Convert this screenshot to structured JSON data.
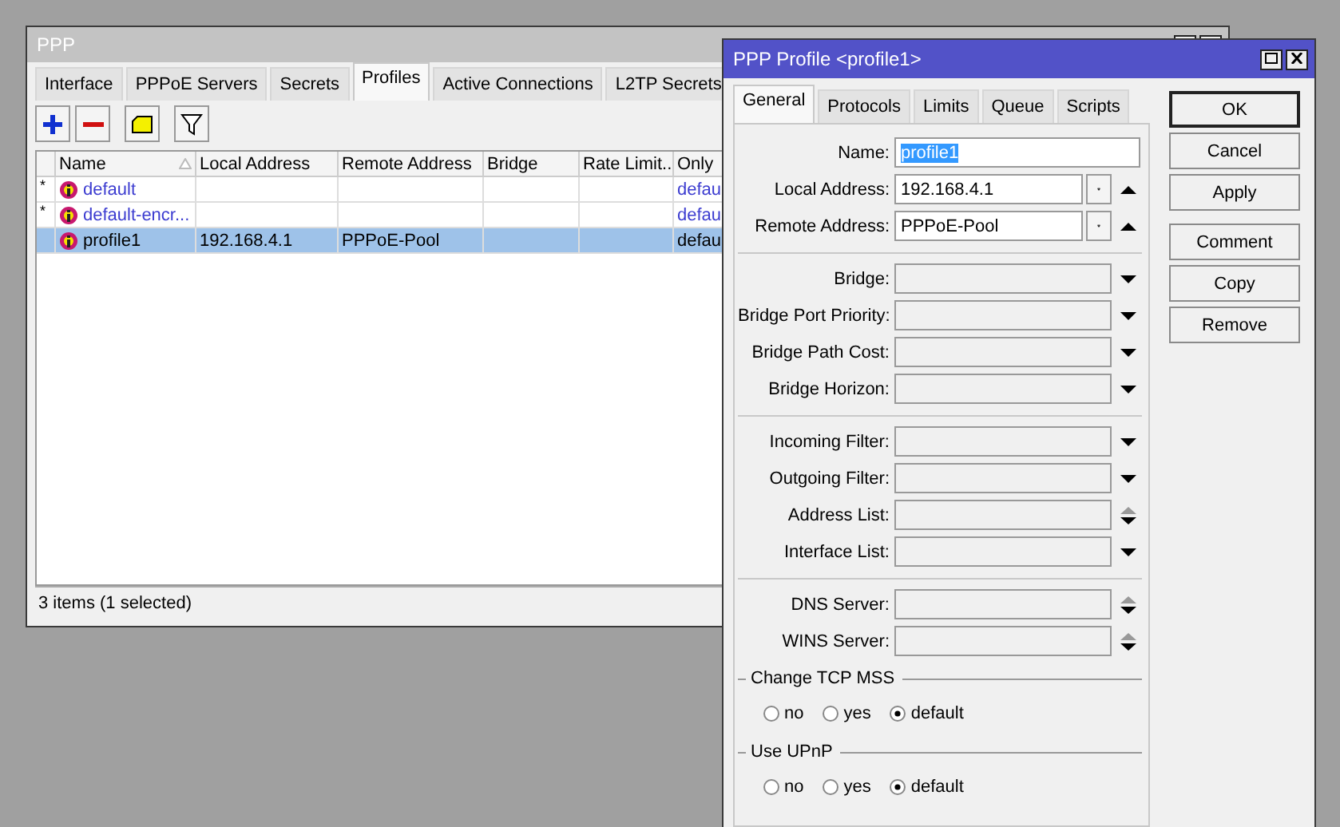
{
  "ppp_window": {
    "title": "PPP",
    "tabs": [
      {
        "label": "Interface",
        "selected": false
      },
      {
        "label": "PPPoE Servers",
        "selected": false
      },
      {
        "label": "Secrets",
        "selected": false
      },
      {
        "label": "Profiles",
        "selected": true
      },
      {
        "label": "Active Connections",
        "selected": false
      },
      {
        "label": "L2TP Secrets",
        "selected": false
      }
    ],
    "table": {
      "columns": [
        {
          "label": "Name",
          "sorted": true
        },
        {
          "label": "Local Address",
          "sorted": false
        },
        {
          "label": "Remote Address",
          "sorted": false
        },
        {
          "label": "Bridge",
          "sorted": false
        },
        {
          "label": "Rate Limit...",
          "sorted": false
        },
        {
          "label": "Only"
        }
      ],
      "rows": [
        {
          "marker": "*",
          "name": "default",
          "only": "defau",
          "default_profile": true,
          "selected": false
        },
        {
          "marker": "*",
          "name": "default-encr...",
          "only": "defau",
          "default_profile": true,
          "selected": false
        },
        {
          "name": "profile1",
          "local_address": "192.168.4.1",
          "remote_address": "PPPoE-Pool",
          "only": "defau",
          "default_profile": false,
          "selected": true
        }
      ]
    },
    "status_bar": "3 items (1 selected)"
  },
  "dialog": {
    "title": "PPP Profile <profile1>",
    "tabs": [
      {
        "label": "General",
        "selected": true
      },
      {
        "label": "Protocols",
        "selected": false
      },
      {
        "label": "Limits",
        "selected": false
      },
      {
        "label": "Queue",
        "selected": false
      },
      {
        "label": "Scripts",
        "selected": false
      }
    ],
    "sections": [
      [
        {
          "label": "Name:",
          "kind": "text",
          "value": "profile1",
          "highlighted": true
        },
        {
          "label": "Local Address:",
          "kind": "combo",
          "value": "192.168.4.1"
        },
        {
          "label": "Remote Address:",
          "kind": "combo",
          "value": "PPPoE-Pool"
        }
      ],
      [
        {
          "label": "Bridge:",
          "kind": "select"
        },
        {
          "label": "Bridge Port Priority:",
          "kind": "select"
        },
        {
          "label": "Bridge Path Cost:",
          "kind": "select"
        },
        {
          "label": "Bridge Horizon:",
          "kind": "select"
        }
      ],
      [
        {
          "label": "Incoming Filter:",
          "kind": "select"
        },
        {
          "label": "Outgoing Filter:",
          "kind": "select"
        },
        {
          "label": "Address List:",
          "kind": "multi"
        },
        {
          "label": "Interface List:",
          "kind": "select"
        }
      ],
      [
        {
          "label": "DNS Server:",
          "kind": "multi"
        },
        {
          "label": "WINS Server:",
          "kind": "multi"
        }
      ]
    ],
    "radio_groups": [
      {
        "title": "Change TCP MSS",
        "options": [
          {
            "label": "no",
            "selected": false
          },
          {
            "label": "yes",
            "selected": false
          },
          {
            "label": "default",
            "selected": true
          }
        ]
      },
      {
        "title": "Use UPnP",
        "options": [
          {
            "label": "no",
            "selected": false
          },
          {
            "label": "yes",
            "selected": false
          },
          {
            "label": "default",
            "selected": true
          }
        ]
      }
    ],
    "buttons": [
      {
        "label": "OK",
        "default": true
      },
      {
        "label": "Cancel",
        "default": false
      },
      {
        "label": "Apply",
        "default": false
      },
      {
        "label": "Comment",
        "default": false
      },
      {
        "label": "Copy",
        "default": false
      },
      {
        "label": "Remove",
        "default": false
      }
    ]
  }
}
